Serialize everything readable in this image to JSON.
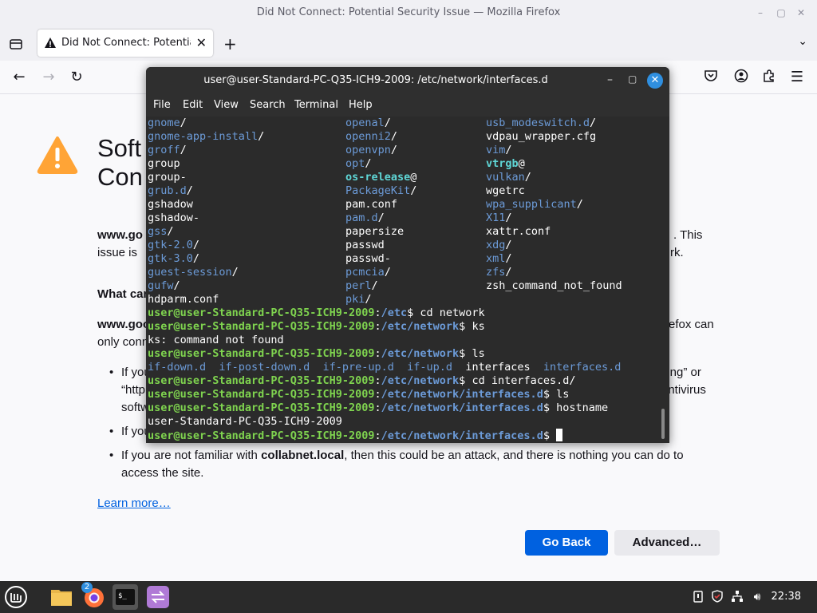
{
  "window": {
    "title": "Did Not Connect: Potential Security Issue — Mozilla Firefox"
  },
  "tab": {
    "label": "Did Not Connect: Potential Security Issue"
  },
  "error_page": {
    "title_line1": "Soft",
    "title_line2": "Con",
    "p1_bold": "www.go",
    "p1_tail_line1": ". This",
    "p1_line2_start": "issue is",
    "p1_line2_end": "rk.",
    "what_can": "What can",
    "p2_start": "www.goo",
    "p2_end": "efox can",
    "p2_line2": "only conn",
    "b1_start": "If you",
    "b1_end": "ning” or",
    "b1_line2_start": "“http",
    "b1_line2_end": "antivirus",
    "b1_line3": "softw",
    "b2_start": "If you",
    "b3_pre": "If you are not familiar with ",
    "b3_bold": "collabnet.local",
    "b3_post": ", then this could be an attack, and there is nothing you can do to",
    "b3_line2": "access the site.",
    "learn_more": "Learn more…",
    "go_back": "Go Back",
    "advanced": "Advanced…"
  },
  "terminal": {
    "title": "user@user-Standard-PC-Q35-ICH9-2009: /etc/network/interfaces.d",
    "menu": [
      "File",
      "Edit",
      "View",
      "Search",
      "Terminal",
      "Help"
    ],
    "ls_rows": [
      [
        [
          "gnome",
          "dir",
          "/"
        ],
        [
          "openal",
          "dir",
          "/"
        ],
        [
          "usb_modeswitch.d",
          "dir",
          "/"
        ]
      ],
      [
        [
          "gnome-app-install",
          "dir",
          "/"
        ],
        [
          "openni2",
          "dir",
          "/"
        ],
        [
          "vdpau_wrapper.cfg",
          "file",
          ""
        ]
      ],
      [
        [
          "groff",
          "dir",
          "/"
        ],
        [
          "openvpn",
          "dir",
          "/"
        ],
        [
          "vim",
          "dir",
          "/"
        ]
      ],
      [
        [
          "group",
          "file",
          ""
        ],
        [
          "opt",
          "dir",
          "/"
        ],
        [
          "vtrgb",
          "lnk",
          "@"
        ]
      ],
      [
        [
          "group-",
          "file",
          ""
        ],
        [
          "os-release",
          "lnk",
          "@"
        ],
        [
          "vulkan",
          "dir",
          "/"
        ]
      ],
      [
        [
          "grub.d",
          "dir",
          "/"
        ],
        [
          "PackageKit",
          "dir",
          "/"
        ],
        [
          "wgetrc",
          "file",
          ""
        ]
      ],
      [
        [
          "gshadow",
          "file",
          ""
        ],
        [
          "pam.conf",
          "file",
          ""
        ],
        [
          "wpa_supplicant",
          "dir",
          "/"
        ]
      ],
      [
        [
          "gshadow-",
          "file",
          ""
        ],
        [
          "pam.d",
          "dir",
          "/"
        ],
        [
          "X11",
          "dir",
          "/"
        ]
      ],
      [
        [
          "gss",
          "dir",
          "/"
        ],
        [
          "papersize",
          "file",
          ""
        ],
        [
          "xattr.conf",
          "file",
          ""
        ]
      ],
      [
        [
          "gtk-2.0",
          "dir",
          "/"
        ],
        [
          "passwd",
          "file",
          ""
        ],
        [
          "xdg",
          "dir",
          "/"
        ]
      ],
      [
        [
          "gtk-3.0",
          "dir",
          "/"
        ],
        [
          "passwd-",
          "file",
          ""
        ],
        [
          "xml",
          "dir",
          "/"
        ]
      ],
      [
        [
          "guest-session",
          "dir",
          "/"
        ],
        [
          "pcmcia",
          "dir",
          "/"
        ],
        [
          "zfs",
          "dir",
          "/"
        ]
      ],
      [
        [
          "gufw",
          "dir",
          "/"
        ],
        [
          "perl",
          "dir",
          "/"
        ],
        [
          "zsh_command_not_found",
          "file",
          ""
        ]
      ],
      [
        [
          "hdparm.conf",
          "file",
          ""
        ],
        [
          "pki",
          "dir",
          "/"
        ],
        [
          "",
          "file",
          ""
        ]
      ]
    ],
    "prompt_user": "user@user-Standard-PC-Q35-ICH9-2009",
    "lines": [
      {
        "path": "/etc",
        "cmd": " cd network"
      },
      {
        "path": "/etc/network",
        "cmd": " ks"
      },
      {
        "out": "ks: command not found"
      },
      {
        "path": "/etc/network",
        "cmd": " ls"
      },
      {
        "ls2": [
          "if-down.d",
          "if-post-down.d",
          "if-pre-up.d",
          "if-up.d",
          "interfaces",
          "interfaces.d"
        ]
      },
      {
        "path": "/etc/network",
        "cmd": " cd interfaces.d/"
      },
      {
        "path": "/etc/network/interfaces.d",
        "cmd": " ls"
      },
      {
        "path": "/etc/network/interfaces.d",
        "cmd": " hostname"
      },
      {
        "out": "user-Standard-PC-Q35-ICH9-2009"
      },
      {
        "path": "/etc/network/interfaces.d",
        "cmd": " "
      }
    ]
  },
  "taskbar": {
    "clock": "22:38",
    "firefox_badge": "2"
  }
}
